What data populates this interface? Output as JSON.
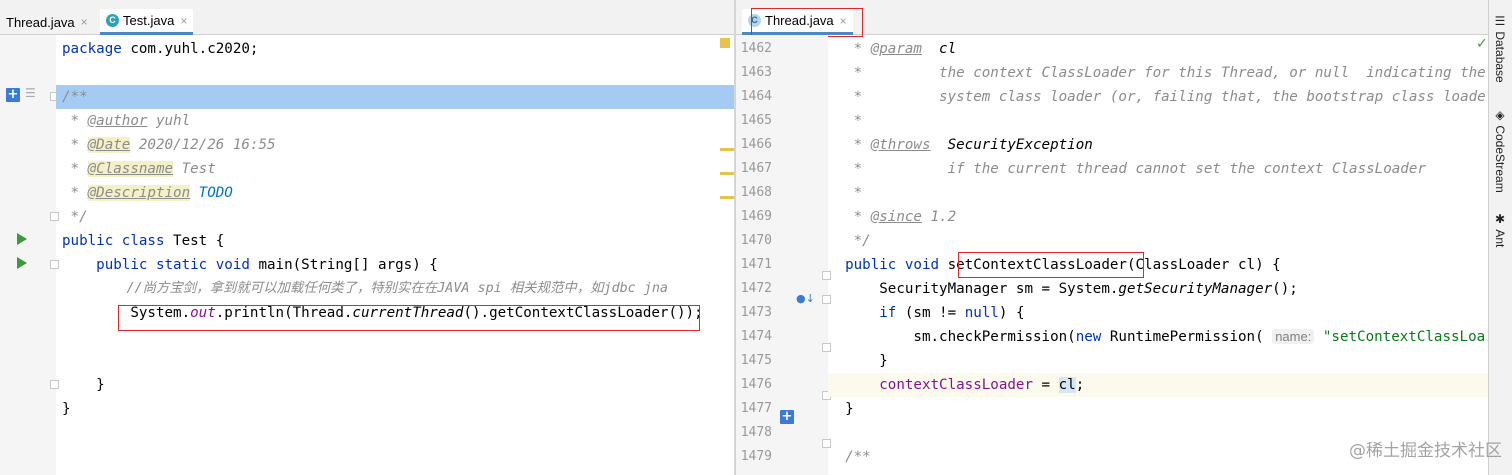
{
  "left_editor": {
    "tabs": [
      {
        "label": "Thread.java",
        "close": "×",
        "active": false,
        "icon": "java-lib-icon"
      },
      {
        "label": "Test.java",
        "close": "×",
        "active": true,
        "icon": "java-class-icon"
      }
    ],
    "lines": {
      "package_kw": "package",
      "package_name": " com.yuhl.c2020;",
      "doc_open": "/**",
      "author_prefix": " * ",
      "author_tag": "@author",
      "author_val": " yuhl",
      "date_prefix": " * ",
      "date_tag": "@Date",
      "date_val": " 2020/12/26 16:55",
      "classname_prefix": " * ",
      "classname_tag": "@Classname",
      "classname_val": " Test",
      "desc_prefix": " * ",
      "desc_tag": "@Description",
      "desc_val": " TODO",
      "doc_close": " */",
      "class_kw": "public class",
      "class_name": " Test {",
      "main_kw": "    public static void",
      "main_sig": " main(String[] args) {",
      "comment": "        //尚方宝剑，拿到就可以加载任何类了，特别实在在JAVA spi 相关规范中，如jdbc jna",
      "println_a": "        System.",
      "println_out": "out",
      "println_b": ".println(Thread.",
      "println_current": "currentThread",
      "println_c": "().getContextClassLoader());",
      "brace_inner": "    }",
      "brace_outer": "}"
    }
  },
  "right_editor": {
    "tabs": [
      {
        "label": "Thread.java",
        "close": "×",
        "active": true,
        "icon": "java-lib-icon"
      }
    ],
    "line_numbers": [
      "1462",
      "1463",
      "1464",
      "1465",
      "1466",
      "1467",
      "1468",
      "1469",
      "1470",
      "1471",
      "1472",
      "1473",
      "1474",
      "1475",
      "1476",
      "1477",
      "1478",
      "1479"
    ],
    "lines": {
      "l1462_prefix": "   * ",
      "l1462_tag": "@param",
      "l1462_val": "  cl",
      "l1463": "   *         the context ClassLoader for this Thread, or null  indicating the",
      "l1464": "   *         system class loader (or, failing that, the bootstrap class loade",
      "l1465": "   *",
      "l1466_prefix": "   * ",
      "l1466_tag": "@throws",
      "l1466_val": "  SecurityException",
      "l1467": "   *          if the current thread cannot set the context ClassLoader",
      "l1468": "   *",
      "l1469_prefix": "   * ",
      "l1469_tag": "@since",
      "l1469_val": " 1.2",
      "l1470": "   */",
      "l1471_kw": "  public void",
      "l1471_name": " setContextClassLoader",
      "l1471_rest": "(ClassLoader cl) {",
      "l1472_a": "      SecurityManager sm = System.",
      "l1472_b": "getSecurityManager",
      "l1472_c": "();",
      "l1473_kw": "      if",
      "l1473_a": " (sm != ",
      "l1473_null": "null",
      "l1473_b": ") {",
      "l1474_a": "          sm.checkPermission(",
      "l1474_new": "new",
      "l1474_b": " RuntimePermission( ",
      "l1474_hint": "name:",
      "l1474_str": " \"setContextClassLoa",
      "l1475": "      }",
      "l1476_indent": "      ",
      "l1476_field": "contextClassLoader",
      "l1476_eq": " = ",
      "l1476_cl": "cl",
      "l1476_semi": ";",
      "l1477": "  }",
      "l1478": "",
      "l1479": "  /**"
    }
  },
  "side_strip": {
    "items": [
      {
        "label": "Database",
        "icon": "database-icon"
      },
      {
        "label": "CodeStream",
        "icon": "codestream-icon"
      },
      {
        "label": "Ant",
        "icon": "ant-icon"
      }
    ]
  },
  "watermark": "@稀土掘金技术社区",
  "colors": {
    "keyword": "#0033b3",
    "comment": "#8c8c8c",
    "field": "#871094",
    "string": "#067d17",
    "highlight": "#e0262b"
  }
}
